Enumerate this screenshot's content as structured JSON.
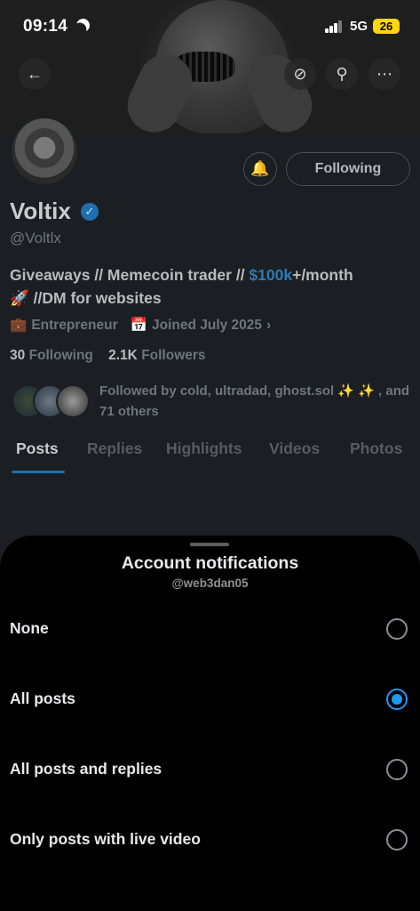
{
  "status_bar": {
    "time": "09:14",
    "network": "5G",
    "battery": "26"
  },
  "profile": {
    "name": "Voltix",
    "handle": "@Voltlx",
    "following_button": "Following",
    "bio_prefix": "Giveaways // Memecoin trader // ",
    "bio_link": "$100k",
    "bio_suffix": "+/month",
    "bio_line2": "🚀 //DM for websites",
    "category": "Entrepreneur",
    "joined": "Joined July 2025",
    "following_count": "30",
    "following_label": "Following",
    "followers_count": "2.1K",
    "followers_label": "Followers",
    "followed_by": "Followed by cold, ultradad, ghost.sol ✨ ✨ , and 71 others",
    "tabs": [
      "Posts",
      "Replies",
      "Highlights",
      "Videos",
      "Photos"
    ],
    "active_tab": "Posts"
  },
  "sheet": {
    "title": "Account notifications",
    "subtitle": "@web3dan05",
    "options": [
      {
        "label": "None",
        "selected": false
      },
      {
        "label": "All posts",
        "selected": true
      },
      {
        "label": "All posts and replies",
        "selected": false
      },
      {
        "label": "Only posts with live video",
        "selected": false
      }
    ]
  },
  "colors": {
    "accent": "#1d9bf0",
    "sheet_bg": "#000000",
    "dim_bg": "#1b1e22"
  },
  "icons": [
    "moon-icon",
    "signal-icon",
    "back-arrow-icon",
    "sync-icon",
    "search-icon",
    "more-icon",
    "bell-icon",
    "verified-icon",
    "briefcase-icon",
    "calendar-icon",
    "chevron-right-icon"
  ]
}
